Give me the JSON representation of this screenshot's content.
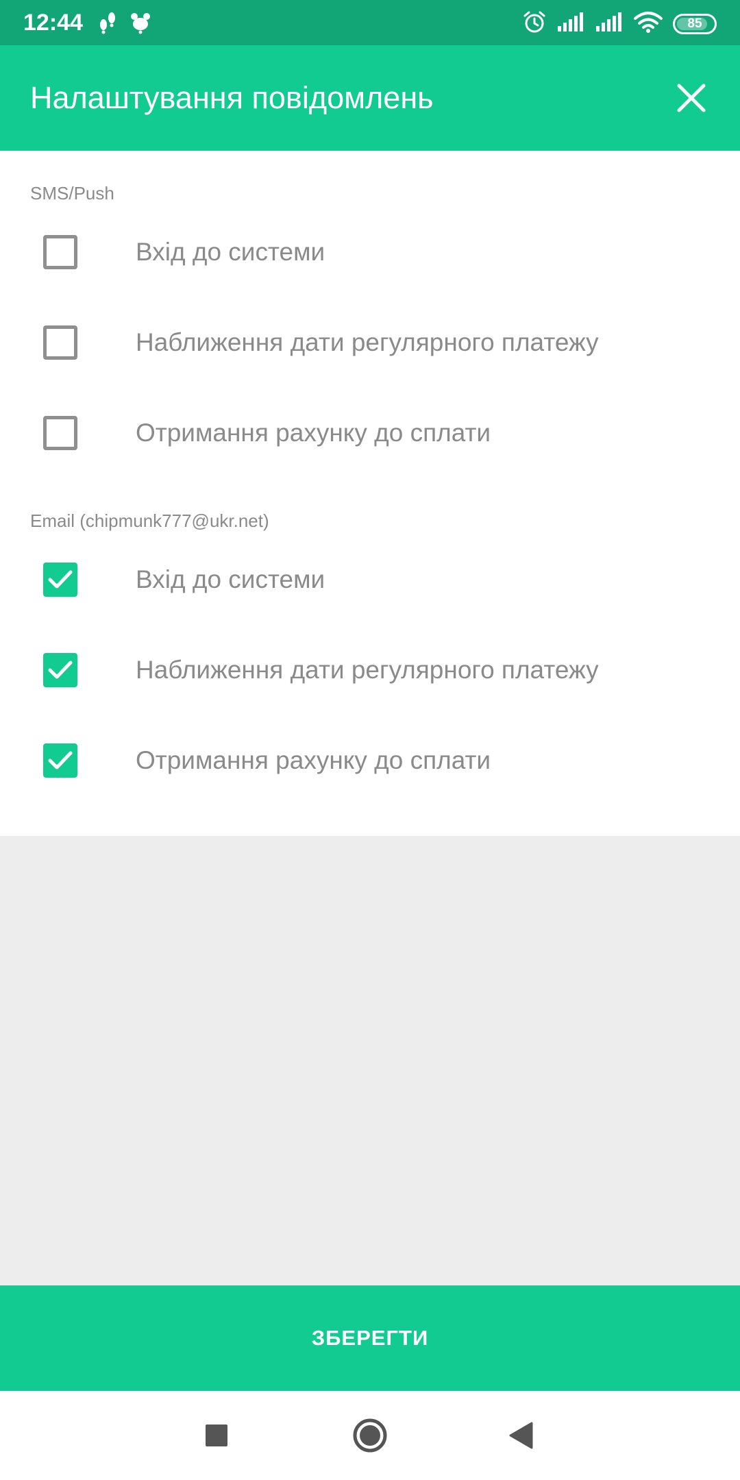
{
  "status_bar": {
    "time": "12:44",
    "battery_level": "85",
    "left_icons": [
      "footprints-icon",
      "pet-paw-icon"
    ],
    "right_icons": [
      "alarm-icon",
      "signal-icon",
      "signal-icon",
      "wifi-icon",
      "battery-icon"
    ]
  },
  "header": {
    "title": "Налаштування повідомлень",
    "close_icon": "close-icon"
  },
  "sms_section": {
    "label": "SMS/Push",
    "options": [
      {
        "label": "Вхід до системи",
        "checked": false
      },
      {
        "label": "Наближення дати регулярного платежу",
        "checked": false
      },
      {
        "label": "Отримання рахунку до сплати",
        "checked": false
      }
    ]
  },
  "email_section": {
    "label": "Email (chipmunk777@ukr.net)",
    "options": [
      {
        "label": "Вхід до системи",
        "checked": true
      },
      {
        "label": "Наближення дати регулярного платежу",
        "checked": true
      },
      {
        "label": "Отримання рахунку до сплати",
        "checked": true
      }
    ]
  },
  "footer": {
    "save_label": "ЗБЕРЕГТИ"
  },
  "nav_bar": {
    "icons": [
      "recents-square-icon",
      "home-circle-icon",
      "back-triangle-icon"
    ]
  },
  "colors": {
    "status_bar": "#12a677",
    "primary": "#12cb90",
    "text_muted": "#8a8a8a",
    "checkbox_border": "#8f8f8f",
    "background": "#ededed"
  }
}
